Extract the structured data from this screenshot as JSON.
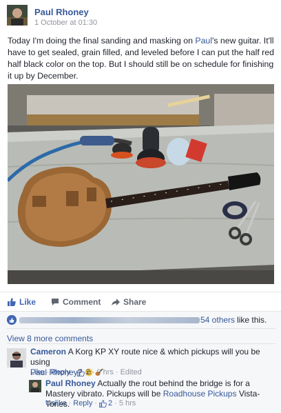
{
  "post": {
    "author": "Paul Rhoney",
    "timestamp": "1 October at 01:30",
    "text_part1": "Today I'm doing the final sanding and masking on ",
    "mention": "Paul",
    "text_part2": "'s new guitar. It'll have to get sealed, grain filled, and leveled before I can put the half red half black color on the top. But I should still be on schedule for finishing it up by December."
  },
  "actions": {
    "like": "Like",
    "comment": "Comment",
    "share": "Share"
  },
  "likes": {
    "others": "54 others",
    "suffix": "like this."
  },
  "view_more": "View 8 more comments",
  "comments": [
    {
      "author": "Cameron",
      "text": "A Korg KP XY route nice & which pickups will you be using",
      "mention": "Paul Rhoney",
      "text_end": "?",
      "like": "Like",
      "reply": "Reply",
      "count": "2",
      "time": "9 hrs",
      "edited": "Edited"
    },
    {
      "author": "Paul Rhoney",
      "text": "Actually the rout behind the bridge is for a Mastery vibrato. Pickups will be",
      "link": "Roadhouse Pickups",
      "text_end": "Vista-Tones.",
      "like": "Unlike",
      "reply": "Reply",
      "count": "2",
      "time": "5 hrs"
    }
  ],
  "colors": {
    "link": "#365899",
    "like_blue": "#4267b2",
    "meta_grey": "#90949c",
    "comment_bg": "#f6f7f9"
  },
  "icons": {
    "like": "thumbs-up-icon",
    "comment": "speech-bubble-icon",
    "share": "share-arrow-icon"
  }
}
